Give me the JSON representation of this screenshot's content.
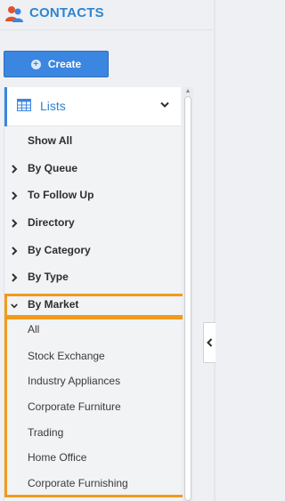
{
  "header": {
    "title": "CONTACTS",
    "icon": "contacts-icon"
  },
  "create_button": {
    "label": "Create",
    "icon": "plus-circle-icon"
  },
  "lists": {
    "label": "Lists",
    "icon": "table-icon",
    "chevron": "chevron-down-icon",
    "accent_color": "#3a86e0"
  },
  "menu": {
    "show_all": "Show All",
    "by_queue": "By Queue",
    "to_follow_up": "To Follow Up",
    "directory": "Directory",
    "by_category": "By Category",
    "by_type": "By Type",
    "by_market": "By Market"
  },
  "by_market_items": [
    "All",
    "Stock Exchange",
    "Industry Appliances",
    "Corporate Furniture",
    "Trading",
    "Home Office",
    "Corporate Furnishing"
  ],
  "colors": {
    "highlight": "#f39a1d",
    "brand": "#2f84cf",
    "button": "#3a86e0"
  }
}
